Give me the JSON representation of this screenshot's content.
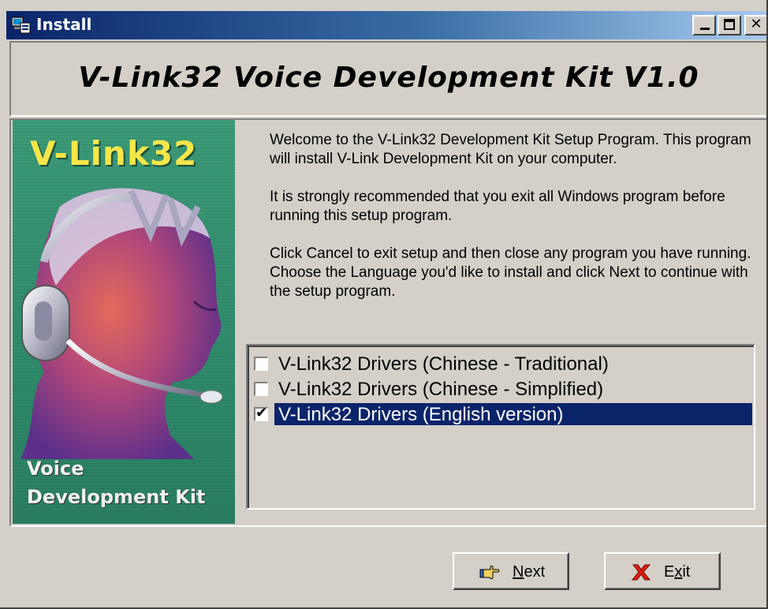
{
  "window": {
    "title": "Install",
    "icon": "installer-computer-icon",
    "controls": [
      "minimize",
      "maximize",
      "close"
    ]
  },
  "header": {
    "title": "V-Link32 Voice Development Kit V1.0"
  },
  "banner": {
    "title": "V-Link32",
    "subtitle_line1": "Voice",
    "subtitle_line2": "Development Kit",
    "image": "headset-woman-illustration",
    "colors": {
      "background": "#2f8a6b",
      "title": "#f6e64a"
    }
  },
  "welcome": {
    "paragraph1": "Welcome to the V-Link32 Development Kit Setup Program. This program will install V-Link Development Kit on your computer.",
    "paragraph2": "It is strongly recommended that you exit all Windows program before running this setup program.",
    "paragraph3": "Click Cancel to exit setup and then close any program you have running. Choose the Language you'd like to install and click Next to continue with the setup program."
  },
  "languages": [
    {
      "label": "V-Link32 Drivers (Chinese - Traditional)",
      "checked": false,
      "selected": false
    },
    {
      "label": "V-Link32 Drivers (Chinese - Simplified)",
      "checked": false,
      "selected": false
    },
    {
      "label": "V-Link32 Drivers (English version)",
      "checked": true,
      "selected": true
    }
  ],
  "buttons": {
    "next": {
      "label_mnemonic": "N",
      "label_rest": "ext",
      "icon": "pointing-hand-icon"
    },
    "exit": {
      "label_first": "E",
      "label_mnemonic": "x",
      "label_rest": "it",
      "icon": "red-x-icon"
    }
  },
  "colors": {
    "title_bar": "#0a246a",
    "selection": "#0a246a",
    "face": "#d4d0c8"
  }
}
